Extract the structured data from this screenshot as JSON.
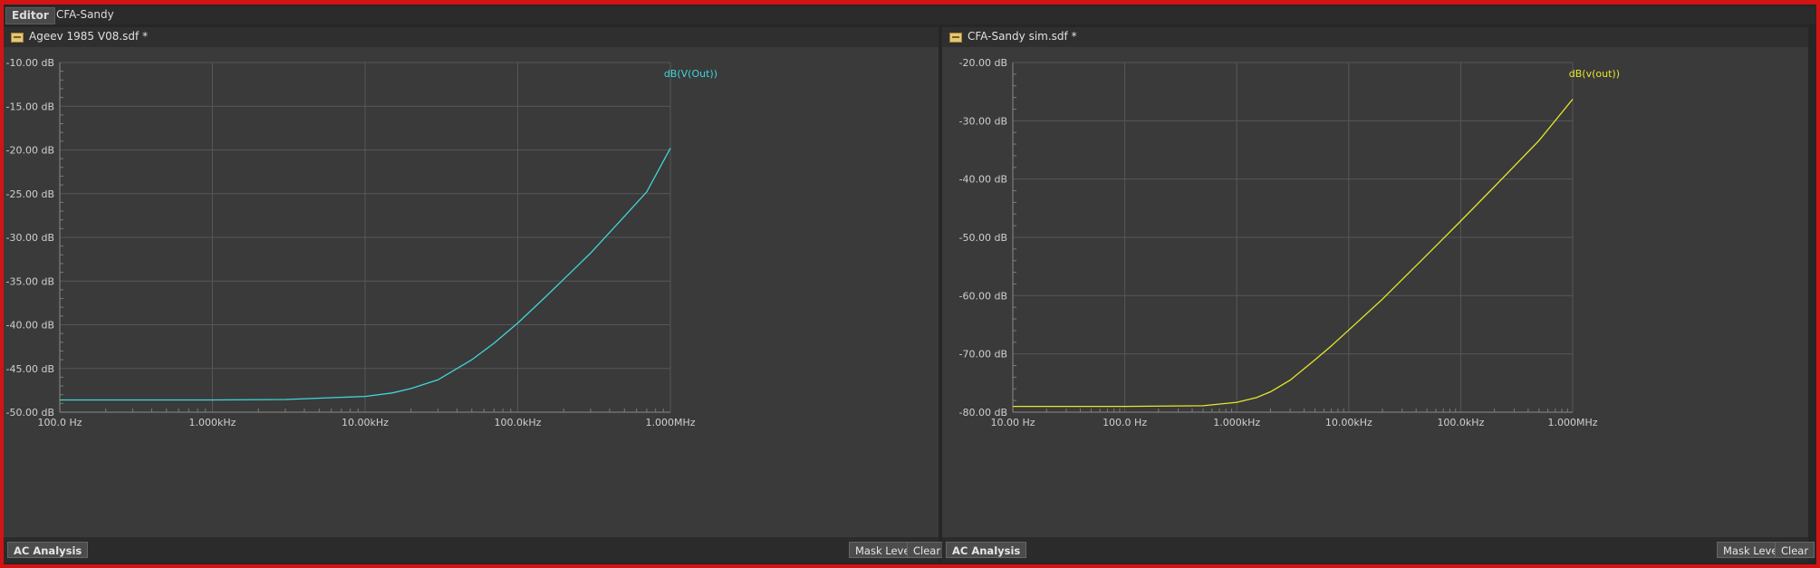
{
  "tabs": [
    {
      "label": "Editor",
      "active": true
    },
    {
      "label": "CFA-Sandy",
      "active": false
    }
  ],
  "colors": {
    "trace_left": "#3fd6dc",
    "trace_right": "#e6e62e",
    "grid": "#575757",
    "border": "#d21414"
  },
  "panels": [
    {
      "title": "Ageev 1985 V08.sdf *",
      "analysis_button": "AC Analysis",
      "mask_level_button": "Mask Level",
      "clear_button": "Clear"
    },
    {
      "title": "CFA-Sandy sim.sdf *",
      "analysis_button": "AC Analysis",
      "mask_level_button": "Mask Level",
      "clear_button": "Clear"
    }
  ],
  "chart_data": [
    {
      "type": "line",
      "x_scale": "log",
      "xlim": [
        100,
        1000000
      ],
      "ylim": [
        -50,
        -10
      ],
      "x_ticks": [
        100,
        1000,
        10000,
        100000,
        1000000
      ],
      "x_tick_labels": [
        "100.0 Hz",
        "1.000kHz",
        "10.00kHz",
        "100.0kHz",
        "1.000MHz"
      ],
      "y_ticks": [
        -10,
        -15,
        -20,
        -25,
        -30,
        -35,
        -40,
        -45,
        -50
      ],
      "y_tick_labels": [
        "-10.00 dB",
        "-15.00 dB",
        "-20.00 dB",
        "-25.00 dB",
        "-30.00 dB",
        "-35.00 dB",
        "-40.00 dB",
        "-45.00 dB",
        "-50.00 dB"
      ],
      "grid": true,
      "legend_position": "top-right",
      "series": [
        {
          "name": "dB(V(Out))",
          "color": "#3fd6dc",
          "x": [
            100,
            1000,
            3000,
            10000,
            15000,
            20000,
            30000,
            50000,
            70000,
            100000,
            150000,
            200000,
            300000,
            500000,
            700000,
            1000000
          ],
          "y": [
            -48.6,
            -48.6,
            -48.55,
            -48.2,
            -47.8,
            -47.3,
            -46.3,
            -44.0,
            -42.1,
            -39.8,
            -36.9,
            -34.8,
            -31.8,
            -27.6,
            -24.8,
            -19.8
          ]
        }
      ]
    },
    {
      "type": "line",
      "x_scale": "log",
      "xlim": [
        10,
        1000000
      ],
      "ylim": [
        -80,
        -20
      ],
      "x_ticks": [
        10,
        100,
        1000,
        10000,
        100000,
        1000000
      ],
      "x_tick_labels": [
        "10.00 Hz",
        "100.0 Hz",
        "1.000kHz",
        "10.00kHz",
        "100.0kHz",
        "1.000MHz"
      ],
      "y_ticks": [
        -20,
        -30,
        -40,
        -50,
        -60,
        -70,
        -80
      ],
      "y_tick_labels": [
        "-20.00 dB",
        "-30.00 dB",
        "-40.00 dB",
        "-50.00 dB",
        "-60.00 dB",
        "-70.00 dB",
        "-80.00 dB"
      ],
      "grid": true,
      "legend_position": "top-right",
      "series": [
        {
          "name": "dB(v(out))",
          "color": "#e6e62e",
          "x": [
            10,
            100,
            500,
            1000,
            1500,
            2000,
            3000,
            5000,
            7000,
            10000,
            20000,
            50000,
            100000,
            200000,
            500000,
            1000000
          ],
          "y": [
            -79.0,
            -79.0,
            -78.9,
            -78.3,
            -77.5,
            -76.5,
            -74.5,
            -71.0,
            -68.6,
            -65.9,
            -60.6,
            -53.0,
            -47.2,
            -41.3,
            -33.4,
            -26.3
          ]
        }
      ]
    }
  ]
}
